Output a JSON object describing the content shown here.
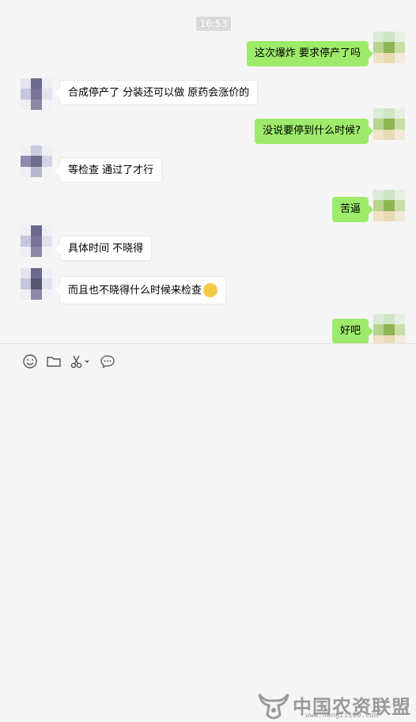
{
  "chat": {
    "timestamp": "16:53",
    "messages": [
      {
        "side": "out",
        "text": "这次爆炸 要求停产了吗"
      },
      {
        "side": "in",
        "text": "合成停产了  分装还可以做    原药会涨价的"
      },
      {
        "side": "out",
        "text": "没说要停到什么时候?"
      },
      {
        "side": "in",
        "text": "等检查  通过了才行"
      },
      {
        "side": "out",
        "text": "苦逼"
      },
      {
        "side": "in",
        "text": "具体时间  不晓得"
      },
      {
        "side": "in",
        "text": "而且也不晓得什么时候来检查",
        "emoji": "smirk-emoji"
      },
      {
        "side": "out",
        "text": "好吧"
      }
    ]
  },
  "toolbar": {
    "icons": [
      "emoji-icon",
      "folder-icon",
      "scissors-icon",
      "chat-history-icon"
    ]
  },
  "watermark": {
    "brand": "中国农资联盟",
    "url": "www.nongzi100.com"
  },
  "colors": {
    "outgoing_bubble": "#9eea6a",
    "incoming_bubble": "#ffffff",
    "background": "#f5f5f5"
  }
}
